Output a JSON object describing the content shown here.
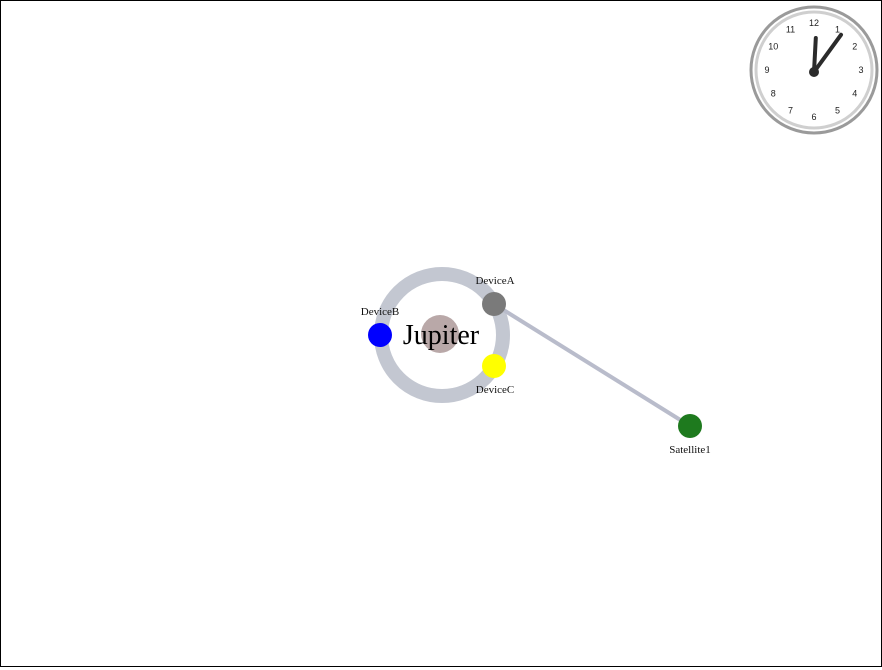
{
  "colors": {
    "background": "#ffffff",
    "border": "#000000",
    "orbit": "#c3c7d1",
    "link": "#b9bccb",
    "planet": "#b9a8a8",
    "clock_ring_outer": "#9a9a9a",
    "clock_ring_inner": "#cfcfcf",
    "clock_hand": "#2b2b2b"
  },
  "planet": {
    "name": "Jupiter",
    "color": "#b9a8a8"
  },
  "devices": [
    {
      "label": "DeviceA",
      "color": "#7a7a7a"
    },
    {
      "label": "DeviceB",
      "color": "#0000ff"
    },
    {
      "label": "DeviceC",
      "color": "#ffff00"
    }
  ],
  "satellites": [
    {
      "label": "Satellite1",
      "color": "#1e7a1e"
    }
  ],
  "links": [
    {
      "from": "DeviceA",
      "to": "Satellite1"
    }
  ],
  "clock": {
    "numbers": [
      "12",
      "1",
      "2",
      "3",
      "4",
      "5",
      "6",
      "7",
      "8",
      "9",
      "10",
      "11"
    ],
    "hour": 12,
    "minute": 6
  }
}
